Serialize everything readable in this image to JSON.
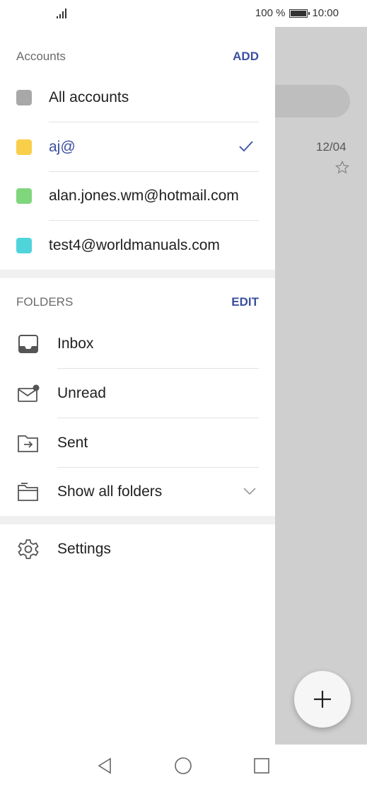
{
  "status_bar": {
    "battery_text": "100 %",
    "time": "10:00"
  },
  "background_app": {
    "date": "12/04"
  },
  "accounts": {
    "title": "Accounts",
    "action": "ADD",
    "items": [
      {
        "label": "All accounts",
        "color": "#a8a8a8",
        "selected": false
      },
      {
        "label": "aj@",
        "color": "#f9cf4a",
        "selected": true
      },
      {
        "label": "alan.jones.wm@hotmail.com",
        "color": "#7fd67c",
        "selected": false
      },
      {
        "label": "test4@worldmanuals.com",
        "color": "#4fd4dc",
        "selected": false
      }
    ]
  },
  "folders": {
    "title": "FOLDERS",
    "action": "EDIT",
    "items": [
      {
        "label": "Inbox",
        "icon": "inbox-icon"
      },
      {
        "label": "Unread",
        "icon": "unread-mail-icon"
      },
      {
        "label": "Sent",
        "icon": "sent-folder-icon"
      },
      {
        "label": "Show all folders",
        "icon": "folders-icon"
      }
    ]
  },
  "settings": {
    "label": "Settings",
    "icon": "gear-icon"
  },
  "colors": {
    "accent": "#3b4fa0",
    "selected_text": "#3b4fa0"
  }
}
